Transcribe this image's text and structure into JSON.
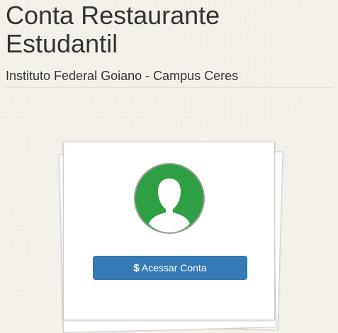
{
  "header": {
    "title": "Conta Restaurante Estudantil",
    "subtitle": "Instituto Federal Goiano - Campus Ceres"
  },
  "card": {
    "avatar_icon": "user-silhouette-icon",
    "avatar_color": "#2ea043",
    "button": {
      "icon": "dollar-icon",
      "icon_glyph": "$",
      "label": "Acessar Conta",
      "color": "#337ab7"
    }
  }
}
